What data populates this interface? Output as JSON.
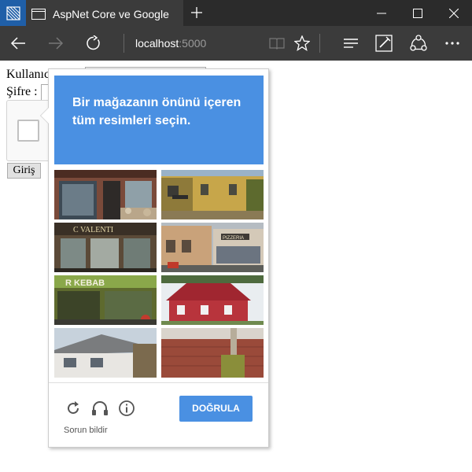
{
  "browser": {
    "tab_title": "AspNet Core ve Google",
    "address_host": "localhost",
    "address_port": ":5000"
  },
  "form": {
    "username_label": "Kullanıcı",
    "password_label": "Şifre :",
    "submit_label": "Giriş"
  },
  "captcha": {
    "instruction": "Bir mağazanın önünü içeren tüm resimleri seçin.",
    "verify_label": "DOĞRULA",
    "report_label": "Sorun bildir",
    "tile_count": 8,
    "tile_signs": [
      "",
      "C VALENTI",
      "",
      "PIZZERIA",
      "R KEBAB",
      "",
      "",
      ""
    ]
  },
  "colors": {
    "accent": "#4a90e2",
    "chrome_dark": "#2b2b2b",
    "chrome_tab": "#3b3b3b",
    "windows_blue": "#1f5fa8"
  },
  "icons": {
    "window": "window-menu-icon",
    "tab": "page-icon",
    "new_tab": "plus-icon",
    "minimize": "minimize-icon",
    "maximize": "maximize-icon",
    "close": "close-icon",
    "back": "back-arrow-icon",
    "forward": "forward-arrow-icon",
    "refresh": "refresh-icon",
    "reading_view": "book-icon",
    "favorite": "star-icon",
    "hub": "hub-icon",
    "notes": "pen-icon",
    "share": "share-icon",
    "more": "more-icon",
    "captcha_reload": "reload-icon",
    "captcha_audio": "headphones-icon",
    "captcha_info": "info-icon"
  }
}
